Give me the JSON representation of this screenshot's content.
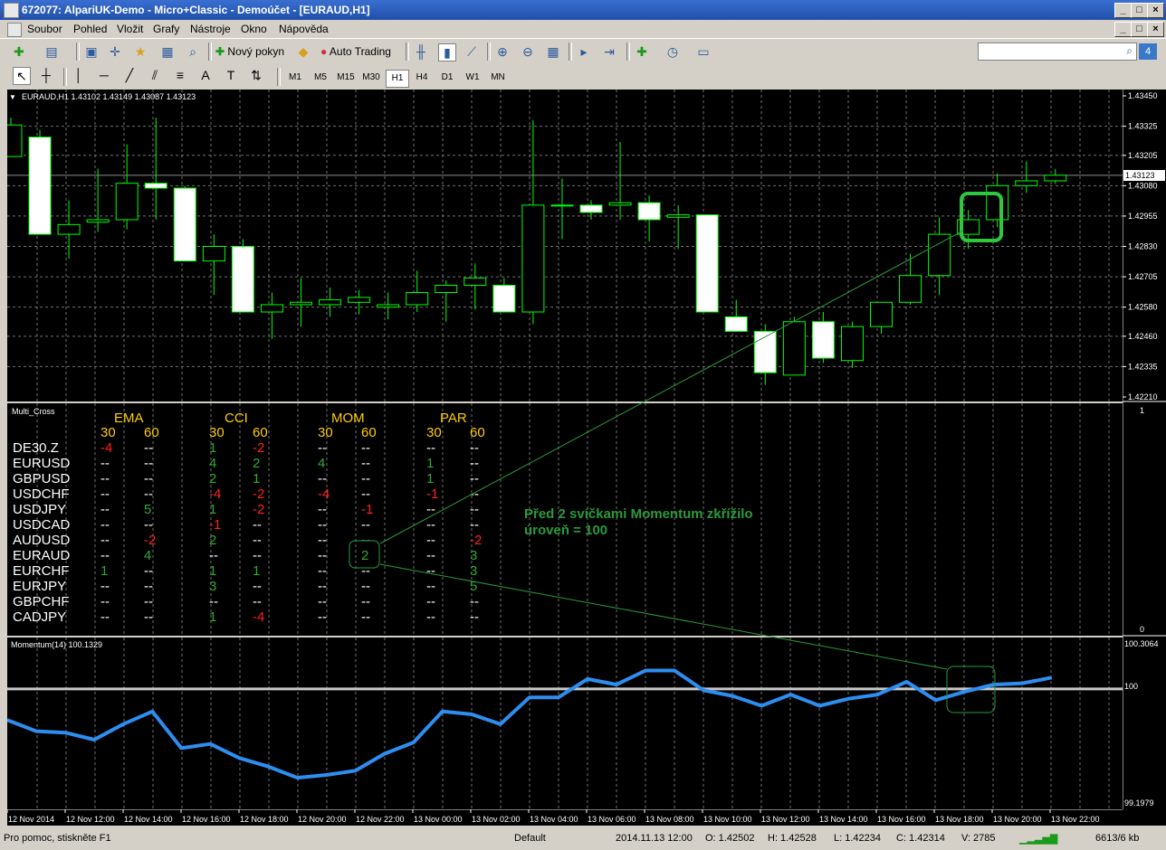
{
  "window": {
    "title": "672077: AlpariUK-Demo - Micro+Classic - Demoúčet - [EURAUD,H1]"
  },
  "menu": [
    "Soubor",
    "Pohled",
    "Vložit",
    "Grafy",
    "Nástroje",
    "Okno",
    "Nápověda"
  ],
  "toolbar": {
    "new_order": "Nový pokyn",
    "auto_trading": "Auto Trading"
  },
  "timeframes": [
    "M1",
    "M5",
    "M15",
    "M30",
    "H1",
    "H4",
    "D1",
    "W1",
    "MN"
  ],
  "active_timeframe": "H1",
  "chart": {
    "header": "EURAUD,H1  1.43102 1.43149 1.43087 1.43123",
    "price_labels": [
      "1.43450",
      "1.43325",
      "1.43205",
      "1.43080",
      "1.42955",
      "1.42830",
      "1.42705",
      "1.42580",
      "1.42460",
      "1.42335",
      "1.42210"
    ],
    "current_price": "1.43123",
    "candles": [
      [
        1.432,
        1.4336,
        1.4326,
        1.4333
      ],
      [
        1.4328,
        1.4331,
        1.4288,
        1.4288
      ],
      [
        1.4288,
        1.4302,
        1.4278,
        1.4292
      ],
      [
        1.4293,
        1.4315,
        1.4289,
        1.4294
      ],
      [
        1.4294,
        1.4325,
        1.429,
        1.4309
      ],
      [
        1.4309,
        1.4336,
        1.4294,
        1.4307
      ],
      [
        1.4307,
        1.4308,
        1.4277,
        1.4277
      ],
      [
        1.4277,
        1.4288,
        1.4263,
        1.4283
      ],
      [
        1.4283,
        1.4286,
        1.4256,
        1.4256
      ],
      [
        1.4256,
        1.4264,
        1.4245,
        1.4259
      ],
      [
        1.4259,
        1.427,
        1.425,
        1.426
      ],
      [
        1.4259,
        1.4266,
        1.4254,
        1.4261
      ],
      [
        1.426,
        1.4265,
        1.4255,
        1.4262
      ],
      [
        1.4258,
        1.4264,
        1.4253,
        1.4259
      ],
      [
        1.4259,
        1.4273,
        1.4256,
        1.4264
      ],
      [
        1.4264,
        1.4269,
        1.4252,
        1.4267
      ],
      [
        1.4267,
        1.4276,
        1.4257,
        1.427
      ],
      [
        1.4267,
        1.427,
        1.4256,
        1.4256
      ],
      [
        1.4256,
        1.4335,
        1.4251,
        1.43
      ],
      [
        1.43,
        1.4311,
        1.4286,
        1.43
      ],
      [
        1.43,
        1.4302,
        1.4294,
        1.4297
      ],
      [
        1.43,
        1.4326,
        1.4294,
        1.4301
      ],
      [
        1.4301,
        1.4304,
        1.4285,
        1.4294
      ],
      [
        1.4295,
        1.43,
        1.4282,
        1.4296
      ],
      [
        1.4296,
        1.4296,
        1.4256,
        1.4256
      ],
      [
        1.4254,
        1.4261,
        1.4248,
        1.4248
      ],
      [
        1.4248,
        1.4251,
        1.4226,
        1.4231
      ],
      [
        1.423,
        1.4254,
        1.423,
        1.4252
      ],
      [
        1.4252,
        1.4256,
        1.4235,
        1.4237
      ],
      [
        1.4236,
        1.4252,
        1.4233,
        1.425
      ],
      [
        1.425,
        1.426,
        1.4247,
        1.426
      ],
      [
        1.426,
        1.428,
        1.4259,
        1.4271
      ],
      [
        1.4271,
        1.4295,
        1.4263,
        1.4288
      ],
      [
        1.4288,
        1.4298,
        1.4282,
        1.4294
      ],
      [
        1.4294,
        1.4313,
        1.4291,
        1.4308
      ],
      [
        1.4308,
        1.4318,
        1.4305,
        1.431
      ],
      [
        1.431,
        1.43149,
        1.43087,
        1.43123
      ]
    ]
  },
  "multi_cross": {
    "title": "Multi_Cross",
    "groups": [
      "EMA",
      "CCI",
      "MOM",
      "PAR"
    ],
    "periods": [
      "30",
      "60",
      "30",
      "60",
      "30",
      "60",
      "30",
      "60"
    ],
    "rows": [
      {
        "sym": "DE30.Z",
        "cells": [
          [
            "-4",
            "r"
          ],
          [
            "--",
            "w"
          ],
          [
            "1",
            "g"
          ],
          [
            "-2",
            "r"
          ],
          [
            "--",
            "w"
          ],
          [
            "--",
            "w"
          ],
          [
            "--",
            "w"
          ],
          [
            "--",
            "w"
          ]
        ]
      },
      {
        "sym": "EURUSD",
        "cells": [
          [
            "--",
            "w"
          ],
          [
            "--",
            "w"
          ],
          [
            "4",
            "g"
          ],
          [
            "2",
            "g"
          ],
          [
            "4",
            "g"
          ],
          [
            "--",
            "w"
          ],
          [
            "1",
            "g"
          ],
          [
            "--",
            "w"
          ]
        ]
      },
      {
        "sym": "GBPUSD",
        "cells": [
          [
            "--",
            "w"
          ],
          [
            "--",
            "w"
          ],
          [
            "2",
            "g"
          ],
          [
            "1",
            "g"
          ],
          [
            "--",
            "w"
          ],
          [
            "--",
            "w"
          ],
          [
            "1",
            "g"
          ],
          [
            "--",
            "w"
          ]
        ]
      },
      {
        "sym": "USDCHF",
        "cells": [
          [
            "--",
            "w"
          ],
          [
            "--",
            "w"
          ],
          [
            "-4",
            "r"
          ],
          [
            "-2",
            "r"
          ],
          [
            "-4",
            "r"
          ],
          [
            "--",
            "w"
          ],
          [
            "-1",
            "r"
          ],
          [
            "--",
            "w"
          ]
        ]
      },
      {
        "sym": "USDJPY",
        "cells": [
          [
            "--",
            "w"
          ],
          [
            "5",
            "g"
          ],
          [
            "1",
            "g"
          ],
          [
            "-2",
            "r"
          ],
          [
            "--",
            "w"
          ],
          [
            "-1",
            "r"
          ],
          [
            "--",
            "w"
          ],
          [
            "--",
            "w"
          ]
        ]
      },
      {
        "sym": "USDCAD",
        "cells": [
          [
            "--",
            "w"
          ],
          [
            "--",
            "w"
          ],
          [
            "-1",
            "r"
          ],
          [
            "--",
            "w"
          ],
          [
            "--",
            "w"
          ],
          [
            "--",
            "w"
          ],
          [
            "--",
            "w"
          ],
          [
            "--",
            "w"
          ]
        ]
      },
      {
        "sym": "AUDUSD",
        "cells": [
          [
            "--",
            "w"
          ],
          [
            "-2",
            "r"
          ],
          [
            "2",
            "g"
          ],
          [
            "--",
            "w"
          ],
          [
            "--",
            "w"
          ],
          [
            "--",
            "w"
          ],
          [
            "--",
            "w"
          ],
          [
            "-2",
            "r"
          ]
        ]
      },
      {
        "sym": "EURAUD",
        "cells": [
          [
            "--",
            "w"
          ],
          [
            "4",
            "g"
          ],
          [
            "--",
            "w"
          ],
          [
            "--",
            "w"
          ],
          [
            "--",
            "w"
          ],
          [
            "2",
            "g"
          ],
          [
            "--",
            "w"
          ],
          [
            "3",
            "g"
          ]
        ]
      },
      {
        "sym": "EURCHF",
        "cells": [
          [
            "1",
            "g"
          ],
          [
            "--",
            "w"
          ],
          [
            "1",
            "g"
          ],
          [
            "1",
            "g"
          ],
          [
            "--",
            "w"
          ],
          [
            "--",
            "w"
          ],
          [
            "--",
            "w"
          ],
          [
            "3",
            "g"
          ]
        ]
      },
      {
        "sym": "EURJPY",
        "cells": [
          [
            "--",
            "w"
          ],
          [
            "--",
            "w"
          ],
          [
            "3",
            "g"
          ],
          [
            "--",
            "w"
          ],
          [
            "--",
            "w"
          ],
          [
            "--",
            "w"
          ],
          [
            "--",
            "w"
          ],
          [
            "5",
            "g"
          ]
        ]
      },
      {
        "sym": "GBPCHF",
        "cells": [
          [
            "--",
            "w"
          ],
          [
            "--",
            "w"
          ],
          [
            "--",
            "w"
          ],
          [
            "--",
            "w"
          ],
          [
            "--",
            "w"
          ],
          [
            "--",
            "w"
          ],
          [
            "--",
            "w"
          ],
          [
            "--",
            "w"
          ]
        ]
      },
      {
        "sym": "CADJPY",
        "cells": [
          [
            "--",
            "w"
          ],
          [
            "--",
            "w"
          ],
          [
            "1",
            "g"
          ],
          [
            "-4",
            "r"
          ],
          [
            "--",
            "w"
          ],
          [
            "--",
            "w"
          ],
          [
            "--",
            "w"
          ],
          [
            "--",
            "w"
          ]
        ]
      }
    ],
    "scale_top": "1",
    "scale_bottom": "0",
    "annotation_line1": "Před 2 svíčkami Momentum zkřížilo",
    "annotation_line2": "úroveň = 100"
  },
  "momentum": {
    "header": "Momentum(14) 100.1329",
    "max_label": "100.3064",
    "level_label": "100",
    "min_label": "99.1979",
    "level": 100.0,
    "values": [
      99.78,
      99.7,
      99.69,
      99.64,
      99.75,
      99.84,
      99.58,
      99.61,
      99.51,
      99.45,
      99.37,
      99.39,
      99.42,
      99.54,
      99.62,
      99.84,
      99.82,
      99.75,
      99.94,
      99.94,
      100.07,
      100.03,
      100.13,
      100.13,
      99.99,
      99.95,
      99.88,
      99.96,
      99.88,
      99.93,
      99.96,
      100.05,
      99.92,
      99.98,
      100.03,
      100.04,
      100.08
    ]
  },
  "time_labels": [
    "12 Nov 2014",
    "12 Nov 12:00",
    "12 Nov 14:00",
    "12 Nov 16:00",
    "12 Nov 18:00",
    "12 Nov 20:00",
    "12 Nov 22:00",
    "13 Nov 00:00",
    "13 Nov 02:00",
    "13 Nov 04:00",
    "13 Nov 06:00",
    "13 Nov 08:00",
    "13 Nov 10:00",
    "13 Nov 12:00",
    "13 Nov 14:00",
    "13 Nov 16:00",
    "13 Nov 18:00",
    "13 Nov 20:00",
    "13 Nov 22:00"
  ],
  "status": {
    "help": "Pro pomoc, stiskněte F1",
    "profile": "Default",
    "datetime": "2014.11.13 12:00",
    "open": "O: 1.42502",
    "high": "H: 1.42528",
    "low": "L: 1.42234",
    "close": "C: 1.42314",
    "volume": "V: 2785",
    "traffic": "6613/6 kb"
  },
  "colors": {
    "bull": "#ffffff",
    "candle_outline": "#00ff00",
    "green": "#32a832",
    "red": "#ff2020",
    "orange": "#ffcc00",
    "momentum": "#2e8ef0",
    "level": "#c8c8c8",
    "annotation": "#2a9a3c"
  }
}
